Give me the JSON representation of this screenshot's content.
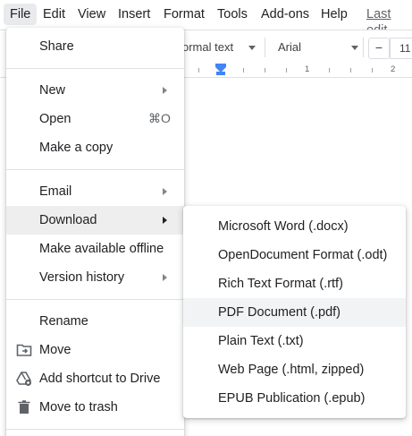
{
  "menubar": {
    "items": [
      "File",
      "Edit",
      "View",
      "Insert",
      "Format",
      "Tools",
      "Add-ons",
      "Help"
    ],
    "last_edit": "Last edit"
  },
  "toolbar": {
    "style_value": "ormal text",
    "font_value": "Arial",
    "font_size_partial": "11",
    "minus_label": "−"
  },
  "ruler": {
    "labels": [
      "1",
      "2"
    ]
  },
  "file_menu": {
    "share": "Share",
    "new": "New",
    "open": "Open",
    "open_shortcut": "⌘O",
    "make_copy": "Make a copy",
    "email": "Email",
    "download": "Download",
    "make_offline": "Make available offline",
    "version_history": "Version history",
    "rename": "Rename",
    "move": "Move",
    "add_shortcut": "Add shortcut to Drive",
    "move_trash": "Move to trash",
    "icons": {
      "move": "move-to-folder-icon",
      "shortcut": "drive-shortcut-icon",
      "trash": "trash-icon"
    }
  },
  "download_menu": {
    "items": [
      "Microsoft Word (.docx)",
      "OpenDocument Format (.odt)",
      "Rich Text Format (.rtf)",
      "PDF Document (.pdf)",
      "Plain Text (.txt)",
      "Web Page (.html, zipped)",
      "EPUB Publication (.epub)"
    ],
    "highlighted": "PDF Document (.pdf)"
  }
}
